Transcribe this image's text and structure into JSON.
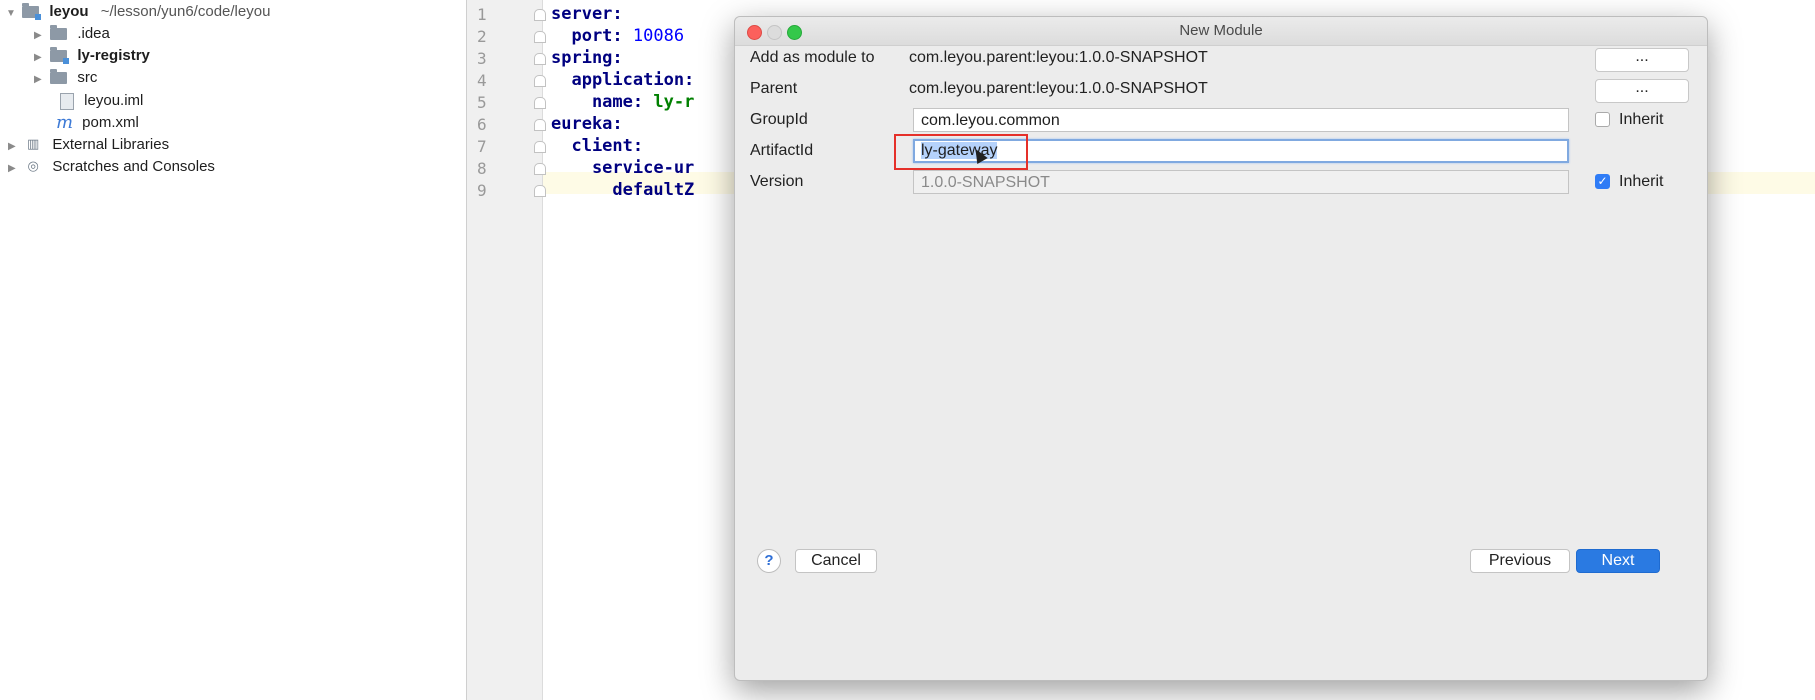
{
  "project_tree": {
    "root": {
      "name": "leyou",
      "path": "~/lesson/yun6/code/leyou"
    },
    "items": [
      {
        "label": ".idea",
        "icon": "folder-icon"
      },
      {
        "label": "ly-registry",
        "icon": "module-folder-icon"
      },
      {
        "label": "src",
        "icon": "folder-icon"
      },
      {
        "label": "leyou.iml",
        "icon": "iml-file-icon"
      },
      {
        "label": "pom.xml",
        "icon": "maven-file-icon"
      },
      {
        "label": "External Libraries",
        "icon": "libraries-icon"
      },
      {
        "label": "Scratches and Consoles",
        "icon": "scratches-icon"
      }
    ],
    "maven_glyph": "m"
  },
  "editor": {
    "line_numbers": [
      "1",
      "2",
      "3",
      "4",
      "5",
      "6",
      "7",
      "8",
      "9"
    ],
    "lines": [
      {
        "key": "server:"
      },
      {
        "key": "  port: ",
        "num": "10086"
      },
      {
        "key": "spring:"
      },
      {
        "key": "  application:"
      },
      {
        "key": "    name: ",
        "val": "ly-r"
      },
      {
        "key": "eureka:"
      },
      {
        "key": "  client:"
      },
      {
        "key": "    service-ur"
      },
      {
        "key": "      defaultZ"
      }
    ]
  },
  "dialog": {
    "title": "New Module",
    "fields": {
      "add_as_module_to": {
        "label": "Add as module to",
        "value": "com.leyou.parent:leyou:1.0.0-SNAPSHOT",
        "button": "..."
      },
      "parent": {
        "label": "Parent",
        "value": "com.leyou.parent:leyou:1.0.0-SNAPSHOT",
        "button": "..."
      },
      "group_id": {
        "label": "GroupId",
        "value": "com.leyou.common",
        "inherit_label": "Inherit",
        "inherit_checked": false
      },
      "artifact_id": {
        "label": "ArtifactId",
        "value": "ly-gateway"
      },
      "version": {
        "label": "Version",
        "value": "1.0.0-SNAPSHOT",
        "inherit_label": "Inherit",
        "inherit_checked": true
      }
    },
    "buttons": {
      "help": "?",
      "cancel": "Cancel",
      "previous": "Previous",
      "next": "Next"
    },
    "check_glyph": "✓"
  },
  "colors": {
    "accent": "#2a7ae2",
    "highlight_box": "#e5302a",
    "close": "#fc605c",
    "minimize": "#dcdcdc",
    "maximize": "#34c84a"
  }
}
